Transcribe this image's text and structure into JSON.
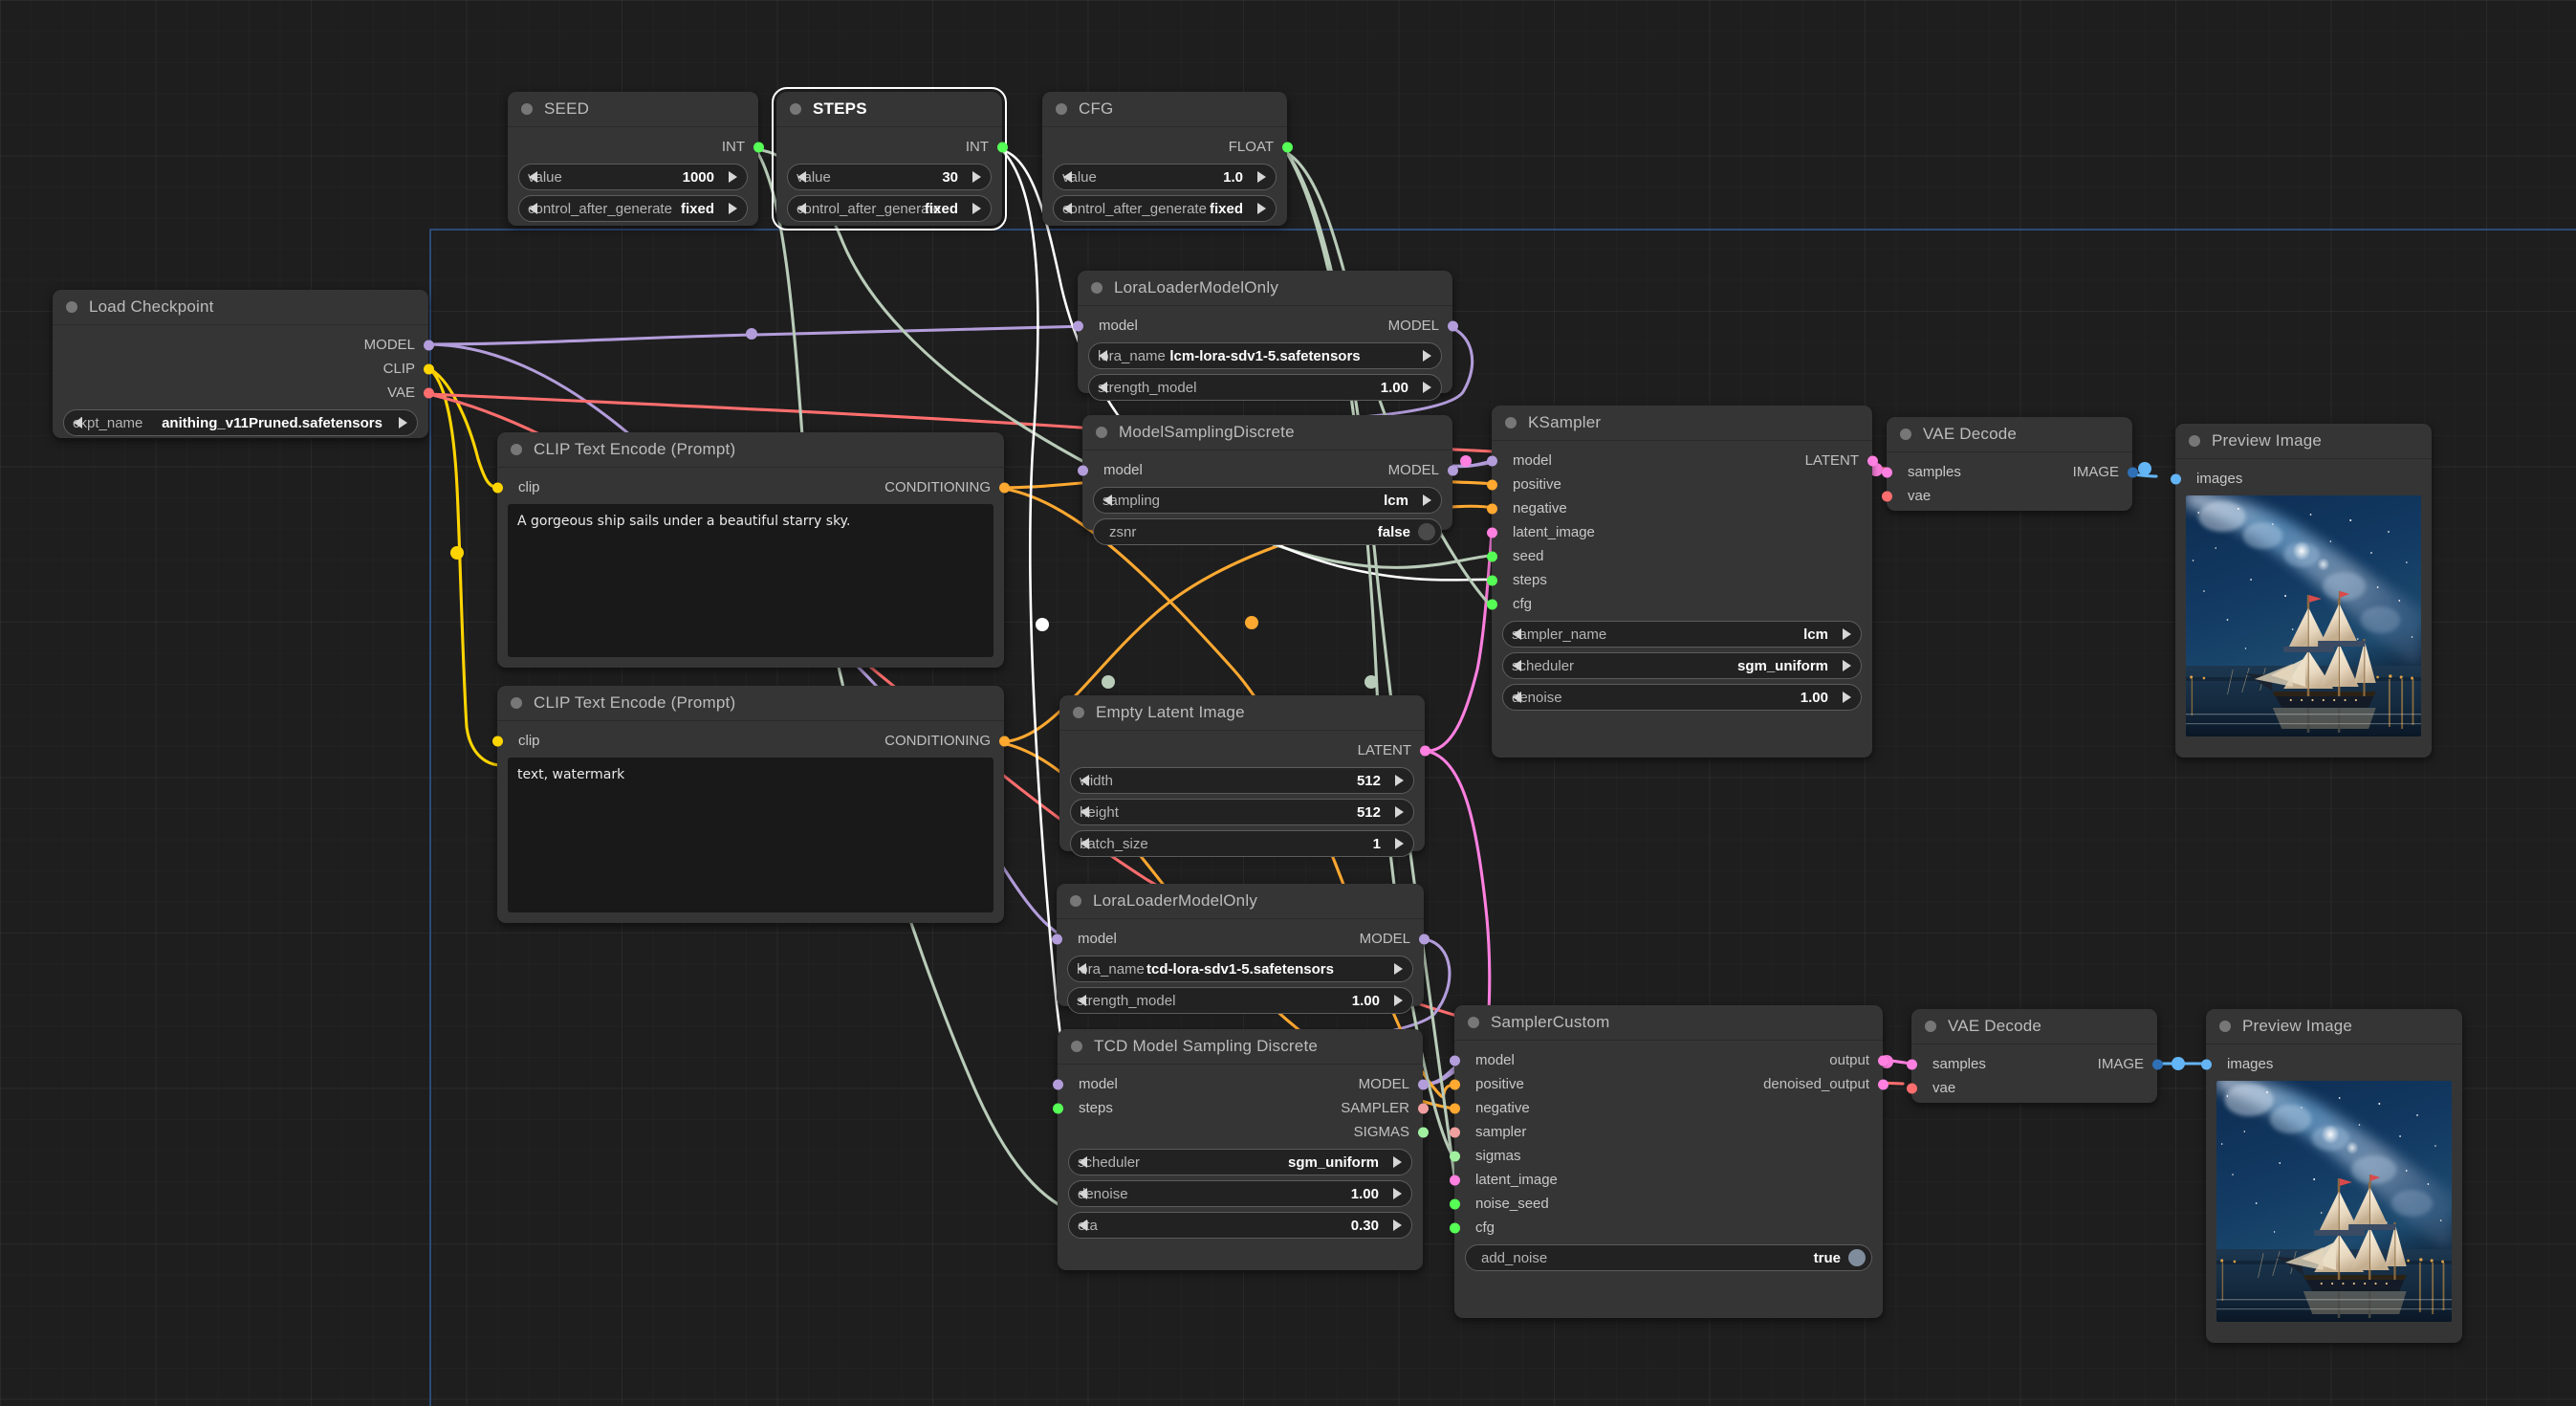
{
  "app": {
    "name": "ComfyUI",
    "canvas_background": "#1e1e1e",
    "group_border_color": "#2d4a77"
  },
  "port_colors": {
    "MODEL": "#b39ddb",
    "CLIP": "#ffd500",
    "VAE": "#ff6e6e",
    "CONDITIONING": "#ffa931",
    "LATENT": "#ff80e0",
    "IMAGE": "#64b5f6",
    "INT": "#56ff56",
    "FLOAT": "#56ff56",
    "SAMPLER": "#f0a0a0",
    "SIGMAS": "#a0f0a0"
  },
  "nodes": {
    "seed": {
      "title": "SEED",
      "outputs": [
        {
          "label": "INT",
          "type": "INT"
        }
      ],
      "widgets": [
        {
          "name": "value",
          "value": "1000",
          "kind": "combo"
        },
        {
          "name": "control_after_generate",
          "value": "fixed",
          "kind": "combo"
        }
      ]
    },
    "steps": {
      "title": "STEPS",
      "selected": true,
      "outputs": [
        {
          "label": "INT",
          "type": "INT"
        }
      ],
      "widgets": [
        {
          "name": "value",
          "value": "30",
          "kind": "combo"
        },
        {
          "name": "control_after_generate",
          "value": "fixed",
          "kind": "combo"
        }
      ]
    },
    "cfg": {
      "title": "CFG",
      "outputs": [
        {
          "label": "FLOAT",
          "type": "FLOAT"
        }
      ],
      "widgets": [
        {
          "name": "value",
          "value": "1.0",
          "kind": "combo"
        },
        {
          "name": "control_after_generate",
          "value": "fixed",
          "kind": "combo"
        }
      ]
    },
    "load_checkpoint": {
      "title": "Load Checkpoint",
      "outputs": [
        {
          "label": "MODEL",
          "type": "MODEL"
        },
        {
          "label": "CLIP",
          "type": "CLIP"
        },
        {
          "label": "VAE",
          "type": "VAE"
        }
      ],
      "widgets": [
        {
          "name": "ckpt_name",
          "value": "anithing_v11Pruned.safetensors",
          "kind": "combo"
        }
      ]
    },
    "lora_lcm": {
      "title": "LoraLoaderModelOnly",
      "inputs": [
        {
          "label": "model",
          "type": "MODEL"
        }
      ],
      "outputs": [
        {
          "label": "MODEL",
          "type": "MODEL"
        }
      ],
      "widgets": [
        {
          "name": "lora_name",
          "value": "lcm-lora-sdv1-5.safetensors",
          "kind": "combo"
        },
        {
          "name": "strength_model",
          "value": "1.00",
          "kind": "combo"
        }
      ]
    },
    "model_sampling_discrete": {
      "title": "ModelSamplingDiscrete",
      "inputs": [
        {
          "label": "model",
          "type": "MODEL"
        }
      ],
      "outputs": [
        {
          "label": "MODEL",
          "type": "MODEL"
        }
      ],
      "widgets": [
        {
          "name": "sampling",
          "value": "lcm",
          "kind": "combo"
        },
        {
          "name": "zsnr",
          "value": "false",
          "kind": "toggle"
        }
      ]
    },
    "clip_positive": {
      "title": "CLIP Text Encode (Prompt)",
      "inputs": [
        {
          "label": "clip",
          "type": "CLIP"
        }
      ],
      "outputs": [
        {
          "label": "CONDITIONING",
          "type": "CONDITIONING"
        }
      ],
      "text": "A gorgeous ship sails under a beautiful starry sky."
    },
    "clip_negative": {
      "title": "CLIP Text Encode (Prompt)",
      "inputs": [
        {
          "label": "clip",
          "type": "CLIP"
        }
      ],
      "outputs": [
        {
          "label": "CONDITIONING",
          "type": "CONDITIONING"
        }
      ],
      "text": "text, watermark"
    },
    "empty_latent": {
      "title": "Empty Latent Image",
      "outputs": [
        {
          "label": "LATENT",
          "type": "LATENT"
        }
      ],
      "widgets": [
        {
          "name": "width",
          "value": "512",
          "kind": "combo"
        },
        {
          "name": "height",
          "value": "512",
          "kind": "combo"
        },
        {
          "name": "batch_size",
          "value": "1",
          "kind": "combo"
        }
      ]
    },
    "lora_tcd": {
      "title": "LoraLoaderModelOnly",
      "inputs": [
        {
          "label": "model",
          "type": "MODEL"
        }
      ],
      "outputs": [
        {
          "label": "MODEL",
          "type": "MODEL"
        }
      ],
      "widgets": [
        {
          "name": "lora_name",
          "value": "tcd-lora-sdv1-5.safetensors",
          "kind": "combo"
        },
        {
          "name": "strength_model",
          "value": "1.00",
          "kind": "combo"
        }
      ]
    },
    "tcd_model_sampling": {
      "title": "TCD Model Sampling Discrete",
      "inputs": [
        {
          "label": "model",
          "type": "MODEL"
        },
        {
          "label": "steps",
          "type": "INT"
        }
      ],
      "outputs": [
        {
          "label": "MODEL",
          "type": "MODEL"
        },
        {
          "label": "SAMPLER",
          "type": "SAMPLER"
        },
        {
          "label": "SIGMAS",
          "type": "SIGMAS"
        }
      ],
      "widgets": [
        {
          "name": "scheduler",
          "value": "sgm_uniform",
          "kind": "combo"
        },
        {
          "name": "denoise",
          "value": "1.00",
          "kind": "combo"
        },
        {
          "name": "eta",
          "value": "0.30",
          "kind": "combo"
        }
      ]
    },
    "ksampler": {
      "title": "KSampler",
      "inputs": [
        {
          "label": "model",
          "type": "MODEL"
        },
        {
          "label": "positive",
          "type": "CONDITIONING"
        },
        {
          "label": "negative",
          "type": "CONDITIONING"
        },
        {
          "label": "latent_image",
          "type": "LATENT"
        },
        {
          "label": "seed",
          "type": "INT"
        },
        {
          "label": "steps",
          "type": "INT"
        },
        {
          "label": "cfg",
          "type": "FLOAT"
        }
      ],
      "outputs": [
        {
          "label": "LATENT",
          "type": "LATENT"
        }
      ],
      "widgets": [
        {
          "name": "sampler_name",
          "value": "lcm",
          "kind": "combo"
        },
        {
          "name": "scheduler",
          "value": "sgm_uniform",
          "kind": "combo"
        },
        {
          "name": "denoise",
          "value": "1.00",
          "kind": "combo"
        }
      ]
    },
    "sampler_custom": {
      "title": "SamplerCustom",
      "inputs": [
        {
          "label": "model",
          "type": "MODEL"
        },
        {
          "label": "positive",
          "type": "CONDITIONING"
        },
        {
          "label": "negative",
          "type": "CONDITIONING"
        },
        {
          "label": "sampler",
          "type": "SAMPLER"
        },
        {
          "label": "sigmas",
          "type": "SIGMAS"
        },
        {
          "label": "latent_image",
          "type": "LATENT"
        },
        {
          "label": "noise_seed",
          "type": "INT"
        },
        {
          "label": "cfg",
          "type": "FLOAT"
        }
      ],
      "outputs": [
        {
          "label": "output",
          "type": "LATENT"
        },
        {
          "label": "denoised_output",
          "type": "LATENT"
        }
      ],
      "widgets": [
        {
          "name": "add_noise",
          "value": "true",
          "kind": "toggle"
        }
      ]
    },
    "vae_decode_top": {
      "title": "VAE Decode",
      "inputs": [
        {
          "label": "samples",
          "type": "LATENT"
        },
        {
          "label": "vae",
          "type": "VAE"
        }
      ],
      "outputs": [
        {
          "label": "IMAGE",
          "type": "IMAGE"
        }
      ]
    },
    "vae_decode_bottom": {
      "title": "VAE Decode",
      "inputs": [
        {
          "label": "samples",
          "type": "LATENT"
        },
        {
          "label": "vae",
          "type": "VAE"
        }
      ],
      "outputs": [
        {
          "label": "IMAGE",
          "type": "IMAGE"
        }
      ]
    },
    "preview_top": {
      "title": "Preview Image",
      "inputs": [
        {
          "label": "images",
          "type": "IMAGE"
        }
      ],
      "image_caption": "Sailing ship under a starry Milky Way night sky over water"
    },
    "preview_bottom": {
      "title": "Preview Image",
      "inputs": [
        {
          "label": "images",
          "type": "IMAGE"
        }
      ],
      "image_caption": "Sailing ship under a starry Milky Way night sky over water"
    }
  }
}
